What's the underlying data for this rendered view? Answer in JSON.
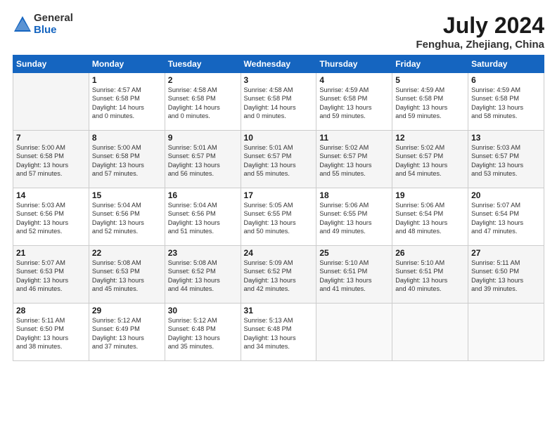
{
  "header": {
    "logo_general": "General",
    "logo_blue": "Blue",
    "title": "July 2024",
    "subtitle": "Fenghua, Zhejiang, China"
  },
  "columns": [
    "Sunday",
    "Monday",
    "Tuesday",
    "Wednesday",
    "Thursday",
    "Friday",
    "Saturday"
  ],
  "weeks": [
    {
      "days": [
        {
          "num": "",
          "info": ""
        },
        {
          "num": "1",
          "info": "Sunrise: 4:57 AM\nSunset: 6:58 PM\nDaylight: 14 hours\nand 0 minutes."
        },
        {
          "num": "2",
          "info": "Sunrise: 4:58 AM\nSunset: 6:58 PM\nDaylight: 14 hours\nand 0 minutes."
        },
        {
          "num": "3",
          "info": "Sunrise: 4:58 AM\nSunset: 6:58 PM\nDaylight: 14 hours\nand 0 minutes."
        },
        {
          "num": "4",
          "info": "Sunrise: 4:59 AM\nSunset: 6:58 PM\nDaylight: 13 hours\nand 59 minutes."
        },
        {
          "num": "5",
          "info": "Sunrise: 4:59 AM\nSunset: 6:58 PM\nDaylight: 13 hours\nand 59 minutes."
        },
        {
          "num": "6",
          "info": "Sunrise: 4:59 AM\nSunset: 6:58 PM\nDaylight: 13 hours\nand 58 minutes."
        }
      ]
    },
    {
      "days": [
        {
          "num": "7",
          "info": "Sunrise: 5:00 AM\nSunset: 6:58 PM\nDaylight: 13 hours\nand 57 minutes."
        },
        {
          "num": "8",
          "info": "Sunrise: 5:00 AM\nSunset: 6:58 PM\nDaylight: 13 hours\nand 57 minutes."
        },
        {
          "num": "9",
          "info": "Sunrise: 5:01 AM\nSunset: 6:57 PM\nDaylight: 13 hours\nand 56 minutes."
        },
        {
          "num": "10",
          "info": "Sunrise: 5:01 AM\nSunset: 6:57 PM\nDaylight: 13 hours\nand 55 minutes."
        },
        {
          "num": "11",
          "info": "Sunrise: 5:02 AM\nSunset: 6:57 PM\nDaylight: 13 hours\nand 55 minutes."
        },
        {
          "num": "12",
          "info": "Sunrise: 5:02 AM\nSunset: 6:57 PM\nDaylight: 13 hours\nand 54 minutes."
        },
        {
          "num": "13",
          "info": "Sunrise: 5:03 AM\nSunset: 6:57 PM\nDaylight: 13 hours\nand 53 minutes."
        }
      ]
    },
    {
      "days": [
        {
          "num": "14",
          "info": "Sunrise: 5:03 AM\nSunset: 6:56 PM\nDaylight: 13 hours\nand 52 minutes."
        },
        {
          "num": "15",
          "info": "Sunrise: 5:04 AM\nSunset: 6:56 PM\nDaylight: 13 hours\nand 52 minutes."
        },
        {
          "num": "16",
          "info": "Sunrise: 5:04 AM\nSunset: 6:56 PM\nDaylight: 13 hours\nand 51 minutes."
        },
        {
          "num": "17",
          "info": "Sunrise: 5:05 AM\nSunset: 6:55 PM\nDaylight: 13 hours\nand 50 minutes."
        },
        {
          "num": "18",
          "info": "Sunrise: 5:06 AM\nSunset: 6:55 PM\nDaylight: 13 hours\nand 49 minutes."
        },
        {
          "num": "19",
          "info": "Sunrise: 5:06 AM\nSunset: 6:54 PM\nDaylight: 13 hours\nand 48 minutes."
        },
        {
          "num": "20",
          "info": "Sunrise: 5:07 AM\nSunset: 6:54 PM\nDaylight: 13 hours\nand 47 minutes."
        }
      ]
    },
    {
      "days": [
        {
          "num": "21",
          "info": "Sunrise: 5:07 AM\nSunset: 6:53 PM\nDaylight: 13 hours\nand 46 minutes."
        },
        {
          "num": "22",
          "info": "Sunrise: 5:08 AM\nSunset: 6:53 PM\nDaylight: 13 hours\nand 45 minutes."
        },
        {
          "num": "23",
          "info": "Sunrise: 5:08 AM\nSunset: 6:52 PM\nDaylight: 13 hours\nand 44 minutes."
        },
        {
          "num": "24",
          "info": "Sunrise: 5:09 AM\nSunset: 6:52 PM\nDaylight: 13 hours\nand 42 minutes."
        },
        {
          "num": "25",
          "info": "Sunrise: 5:10 AM\nSunset: 6:51 PM\nDaylight: 13 hours\nand 41 minutes."
        },
        {
          "num": "26",
          "info": "Sunrise: 5:10 AM\nSunset: 6:51 PM\nDaylight: 13 hours\nand 40 minutes."
        },
        {
          "num": "27",
          "info": "Sunrise: 5:11 AM\nSunset: 6:50 PM\nDaylight: 13 hours\nand 39 minutes."
        }
      ]
    },
    {
      "days": [
        {
          "num": "28",
          "info": "Sunrise: 5:11 AM\nSunset: 6:50 PM\nDaylight: 13 hours\nand 38 minutes."
        },
        {
          "num": "29",
          "info": "Sunrise: 5:12 AM\nSunset: 6:49 PM\nDaylight: 13 hours\nand 37 minutes."
        },
        {
          "num": "30",
          "info": "Sunrise: 5:12 AM\nSunset: 6:48 PM\nDaylight: 13 hours\nand 35 minutes."
        },
        {
          "num": "31",
          "info": "Sunrise: 5:13 AM\nSunset: 6:48 PM\nDaylight: 13 hours\nand 34 minutes."
        },
        {
          "num": "",
          "info": ""
        },
        {
          "num": "",
          "info": ""
        },
        {
          "num": "",
          "info": ""
        }
      ]
    }
  ]
}
